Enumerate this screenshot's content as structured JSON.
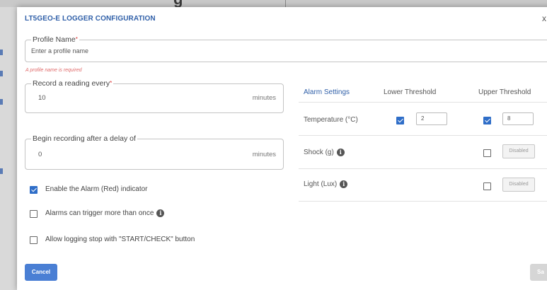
{
  "background": {
    "title_fragment": "g"
  },
  "dialog": {
    "title": "LT5GEO-E LOGGER CONFIGURATION",
    "close_glyph": "x"
  },
  "profile": {
    "label": "Profile Name",
    "required_mark": "*",
    "placeholder": "Enter a profile name",
    "error": "A profile name is required"
  },
  "record_every": {
    "label": "Record a reading every",
    "required_mark": "*",
    "value": "10",
    "unit": "minutes"
  },
  "delay": {
    "label": "Begin recording after a delay of",
    "value": "0",
    "unit": "minutes"
  },
  "options": [
    {
      "label": "Enable the Alarm (Red) indicator",
      "checked": true
    },
    {
      "label": "Alarms can trigger more than once",
      "checked": false,
      "info_icon": "info-icon"
    },
    {
      "label": "Allow logging stop with \"START/CHECK\" button",
      "checked": false
    }
  ],
  "alarm_table": {
    "headers": [
      "Alarm Settings",
      "Lower Threshold",
      "Upper Threshold"
    ],
    "rows": [
      {
        "label": "Temperature (°C)",
        "lower_checked": true,
        "lower_value": "2",
        "upper_checked": true,
        "upper_value": "8"
      },
      {
        "label": "Shock (g)",
        "info_icon": "info-icon",
        "upper_checked": false,
        "upper_button": "Disabled"
      },
      {
        "label": "Light (Lux)",
        "info_icon": "info-icon",
        "upper_checked": false,
        "upper_button": "Disabled"
      }
    ]
  },
  "buttons": {
    "cancel": "Cancel",
    "save": "Sa"
  },
  "colors": {
    "accent": "#2f5fa8",
    "button_primary": "#4a7fd4",
    "error": "#e06a6a",
    "checkbox": "#2f6ec8"
  }
}
